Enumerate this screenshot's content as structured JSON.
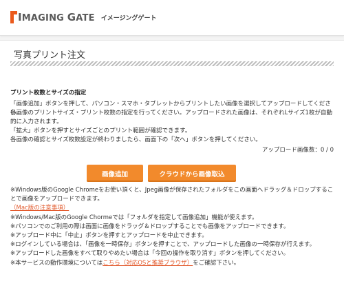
{
  "header": {
    "logo_initial_1": "I",
    "logo_rest_1": "MAGING ",
    "logo_initial_2": "G",
    "logo_rest_2": "ATE",
    "logo_sub": "イメージングゲート"
  },
  "page": {
    "title": "写真プリント注文",
    "section_title": "プリント枚数とサイズの指定",
    "desc": [
      "「画像追加」ボタンを押して、パソコン・スマホ・タブレットからプリントしたい画像を選択してアップロードしてください。",
      "各画像のプリントサイズ・プリント枚数の指定を行ってください。アップロードされた画像は、それぞれLサイズ1枚が自動的に入力されます。",
      "「拡大」ボタンを押すとサイズごとのプリント範囲が確認できます。",
      "各画像の確認とサイズ枚数設定が終わりましたら、画面下の「次へ」ボタンを押してください。"
    ],
    "upload_count_label": "アップロード画像数：",
    "upload_count_value": "0 / 0"
  },
  "buttons": {
    "add_image": "画像追加",
    "cloud_import": "クラウドから画像取込"
  },
  "notes": {
    "n1": "※Windows版のGoogle Chromeをお使い頂くと、Jpeg画像が保存されたフォルダをこの画面へドラッグ＆ドロップすることで画像をアップロードできます。",
    "mac_link": "（Mac版の注意事項）",
    "n2": "※Windows/Mac版のGoogle Chormeでは「フォルダを指定して画像追加」機能が使えます。",
    "n3": "※パソコンでのご利用の際は画面に画像をドラッグ＆ドロップすることでも画像をアップロードできます。",
    "n4": "※アップロード中に「中止」ボタンを押すとアップロードを中止できます。",
    "n5": "※ログインしている場合は、「画像を一時保存」ボタンを押すことで、アップロードした画像の一時保存が行えます。",
    "n6": "※アップロードした画像をすべて取りやめたい場合は「今回の操作を取り消す」ボタンを押してください。",
    "n7_pre": "※本サービスの動作環境については",
    "n7_link": "こちら（対応OSと推奨ブラウザ）",
    "n7_post": "をご確認下さい。"
  },
  "colors": {
    "accent": "#f28a2c",
    "link": "#e2582a",
    "logo": "#ea5a1c"
  }
}
